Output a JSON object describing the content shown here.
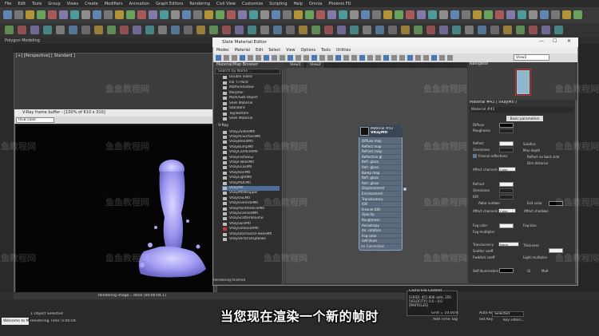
{
  "app": {
    "menu": [
      "File",
      "Edit",
      "Tools",
      "Group",
      "Views",
      "Create",
      "Modifiers",
      "Animation",
      "Graph Editors",
      "Rendering",
      "Civil View",
      "Customize",
      "Scripting",
      "Help",
      "Omnia",
      "Phoenix FD"
    ],
    "ribbon_label": "Polygon Modeling",
    "viewport_label": "[+] [Perspective] [ Standard ]"
  },
  "vfb": {
    "title": "V-Ray frame buffer - [100% of 610 x 310]",
    "channel": "RGB color"
  },
  "slate": {
    "title": "Slate Material Editor",
    "menu": [
      "Modes",
      "Material",
      "Edit",
      "Select",
      "View",
      "Options",
      "Tools",
      "Utilities"
    ],
    "view_select": "View2",
    "browser_title": "Material/Map Browser",
    "search_placeholder": "Search by Name ...",
    "standard_items": [
      "Double Sided",
      "Ink 'n Paint",
      "Matte/Shadow",
      "Morpher",
      "Multi/Sub-Object",
      "Shell Material",
      "Standard",
      "Top/Bottom",
      "Shell Material"
    ],
    "vray_header": "- V-Ray",
    "vray_items": [
      "VRay2SidedMtl",
      "VRayALSurfaceMtl",
      "VRayBlendMtl",
      "VRayBumpMtl",
      "VRayCarPaintMtl",
      "VRayFastSSS2",
      "VRayFlakesMtl",
      "VRayGLSLMtl",
      "VRayHairMtl",
      "VRayLightMtl",
      "VRayMDLMtl",
      "VRayMtl",
      "VRayMtlWrapper",
      "VRayOSLMtl",
      "VRayOverrideMtl",
      "VRayPointParticleMtl",
      "VRayScannedMtl",
      "VRayScatterVolume",
      "VRaySkinMtl",
      "VRaySimbiontMtl",
      "VRayStochasticFlakesMtl",
      "VRayVectorDisplBake"
    ],
    "selected_item": "VRayMtl",
    "view_tabs": [
      "View1",
      "View2"
    ],
    "status": "Rendering finished"
  },
  "node": {
    "material_id": "Material #43",
    "type": "VRayMtl",
    "slots": [
      "Diffuse map",
      "Reflect map",
      "Refract map",
      "Reflection gl",
      "Refl. gloss",
      "Refr. gloss",
      "Bump map",
      "Refl. gloss",
      "Refr. gloss",
      "Displacement",
      "Environment",
      "Translucency",
      "IOR",
      "Fresnel IOR",
      "Opacity",
      "Roughness",
      "Anisotropy",
      "An. rotation",
      "Fog color",
      "Self-illum"
    ],
    "footer": "mr Connection"
  },
  "navigator": {
    "title": "Navigator"
  },
  "params": {
    "title": "Material #43 ( VRayMtl )",
    "id": "Material #43",
    "basic": "Basic parameters",
    "labels": {
      "diffuse": "Diffuse",
      "roughness": "Roughness",
      "reflect": "Reflect",
      "glossiness": "Glossiness",
      "fresnel": "Fresnel reflections",
      "affect": "Affect channels",
      "affect_val": "Color only",
      "subdivs": "Subdivs",
      "max_depth": "Max depth",
      "back_side": "Reflect on back side",
      "dim_dist": "Dim distance",
      "refract": "Refract",
      "ior": "IOR",
      "abbe": "Abbe number",
      "exit_color": "Exit color",
      "affect_shadows": "Affect shadows",
      "fog_color": "Fog color",
      "fog_mult": "Fog multiplier",
      "fog_bias": "Fog bias",
      "translucency": "Translucency",
      "translucency_val": "None",
      "scatter": "Scatter coeff",
      "fwd_bck": "Fwd/bck coeff",
      "thickness": "Thickness",
      "light_mult": "Light multiplier",
      "self_illum": "Self-illumination",
      "gi": "GI",
      "mult": "Mult"
    }
  },
  "status": {
    "timeline_text": "Rendering image... done [00:00:04.1]",
    "selected": "1 Object Selected",
    "render_time": "Rendering Time: 0:00:04",
    "welcome": "Welcome to M",
    "cache_title": "Cache File Content",
    "cache_lines": "[GRID]: 451.806 cells, 250\n[VELOCITY]: 0.0 - 0.0\n[PARTICLES]",
    "grid": "Grid = 10.0cm",
    "add_time": "Add Time Tag",
    "auto_key": "Auto Key",
    "set_key": "Set Key",
    "selected_dd": "Selected",
    "key_filters": "Key Filters..."
  },
  "subtitle": "当您现在渲染一个新的帧时",
  "watermark": "鱼鱼教程网"
}
